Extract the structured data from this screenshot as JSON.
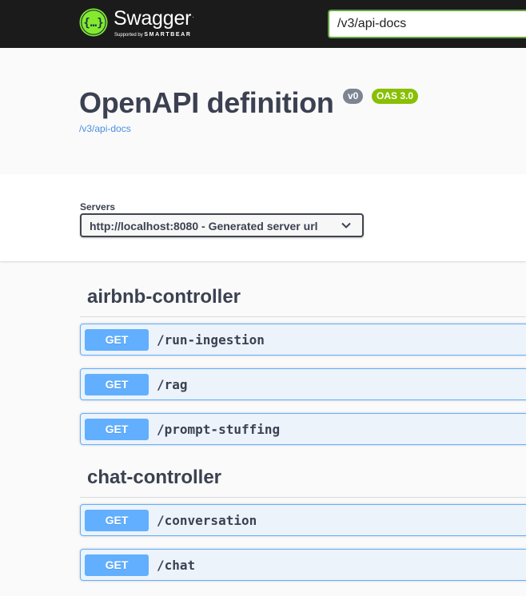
{
  "topbar": {
    "logo_title": "Swagger",
    "logo_tm": ".",
    "logo_supported": "Supported by",
    "logo_brand": "SMARTBEAR",
    "url_value": "/v3/api-docs"
  },
  "info": {
    "title": "OpenAPI definition",
    "version_badge": "v0",
    "oas_badge": "OAS 3.0",
    "spec_link": "/v3/api-docs"
  },
  "servers": {
    "label": "Servers",
    "selected": "http://localhost:8080 - Generated server url"
  },
  "tags": [
    {
      "name": "airbnb-controller",
      "operations": [
        {
          "method": "GET",
          "path": "/run-ingestion"
        },
        {
          "method": "GET",
          "path": "/rag"
        },
        {
          "method": "GET",
          "path": "/prompt-stuffing"
        }
      ]
    },
    {
      "name": "chat-controller",
      "operations": [
        {
          "method": "GET",
          "path": "/conversation"
        },
        {
          "method": "GET",
          "path": "/chat"
        }
      ]
    }
  ],
  "colors": {
    "get_method": "#61affe",
    "get_background": "#ecf3fb",
    "swagger_green": "#85ea2d",
    "topbar": "#1b1b1b"
  }
}
